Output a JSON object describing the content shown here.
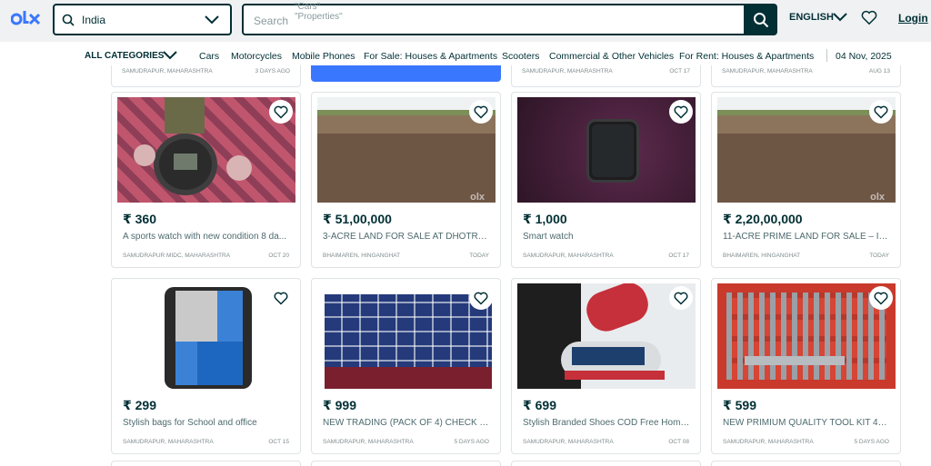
{
  "header": {
    "location": "India",
    "search_placeholder": "Search",
    "search_rotating": "\"Cars\"\n\"Properties\"",
    "language": "ENGLISH",
    "login": "Login"
  },
  "categories": {
    "all_label": "ALL CATEGORIES",
    "items": [
      "Cars",
      "Motorcycles",
      "Mobile Phones",
      "For Sale: Houses & Apartments",
      "Scooters",
      "Commercial & Other Vehicles",
      "For Rent: Houses & Apartments"
    ],
    "date": "04 Nov, 2025"
  },
  "previous_row": [
    {
      "location": "SAMUDRAPUR, MAHARASHTRA",
      "date": "3 DAYS AGO"
    },
    {
      "location": "SAMUDRAPUR, MAHARASHTRA",
      "date": "OCT 17"
    },
    {
      "location": "SAMUDRAPUR, MAHARASHTRA",
      "date": "AUG 13"
    }
  ],
  "listings": [
    {
      "price": "₹ 360",
      "title": "A sports watch with new condition 8 da...",
      "location": "SAMUDRAPUR MIDC, MAHARASHTRA",
      "date": "OCT 20"
    },
    {
      "price": "₹ 51,00,000",
      "title": "3-ACRE LAND FOR SALE AT DHOTRA C...",
      "location": "BHAIMAREN, HINGANGHAT",
      "date": "TODAY"
    },
    {
      "price": "₹ 1,000",
      "title": "Smart watch",
      "location": "SAMUDRAPUR, MAHARASHTRA",
      "date": "OCT 17"
    },
    {
      "price": "₹ 2,20,00,000",
      "title": "11-ACRE PRIME LAND FOR SALE – IDE...",
      "location": "BHAIMAREN, HINGANGHAT",
      "date": "TODAY"
    },
    {
      "price": "₹ 299",
      "title": "Stylish bags for School and office",
      "location": "SAMUDRAPUR, MAHARASHTRA",
      "date": "OCT 15"
    },
    {
      "price": "₹ 999",
      "title": "NEW TRADING (PACK OF 4) CHECK SH...",
      "location": "SAMUDRAPUR, MAHARASHTRA",
      "date": "5 DAYS AGO"
    },
    {
      "price": "₹ 699",
      "title": "Stylish Branded Shoes COD Free Home...",
      "location": "SAMUDRAPUR, MAHARASHTRA",
      "date": "OCT 08"
    },
    {
      "price": "₹ 599",
      "title": "NEW PRIMIUM QUALITY TOOL KIT 46 ...",
      "location": "SAMUDRAPUR, MAHARASHTRA",
      "date": "5 DAYS AGO"
    }
  ],
  "watermark": "olx",
  "colors": {
    "brand": "#002f34",
    "logo_blue": "#3a77ff",
    "header_bg": "#eff1f3"
  }
}
